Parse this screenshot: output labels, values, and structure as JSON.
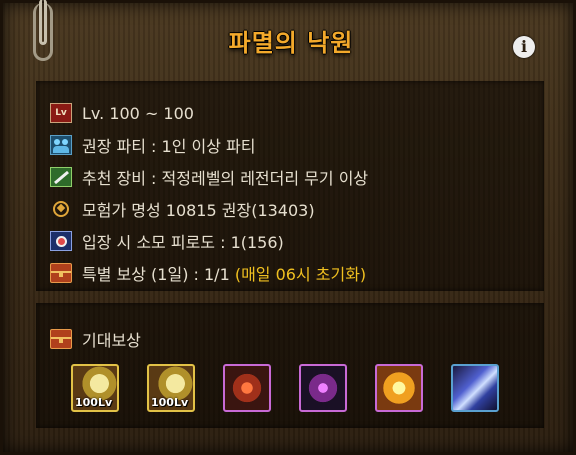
{
  "title": "파멸의 낙원",
  "info_icon": "i",
  "requirements": [
    {
      "icon": "level-icon",
      "icon_text": "Lv",
      "text": "Lv. 100 ~ 100"
    },
    {
      "icon": "party-icon",
      "text": "권장 파티 : 1인 이상 파티"
    },
    {
      "icon": "equipment-icon",
      "text": "추천 장비 : 적정레벨의 레전더리 무기 이상"
    },
    {
      "icon": "fame-icon",
      "text": "모험가 명성 10815 권장(13403)"
    },
    {
      "icon": "fatigue-icon",
      "text": "입장 시 소모 피로도 : 1(156)"
    },
    {
      "icon": "chest-icon",
      "text": "특별 보상 (1일) : 1/1 ",
      "highlight": "(매일 06시 초기화)",
      "highlight_color": "#f0c020"
    }
  ],
  "rewards": {
    "label": "기대보상",
    "items": [
      {
        "name": "equipment-box-icon",
        "level_text": "100Lv"
      },
      {
        "name": "equipment-box-icon",
        "level_text": "100Lv"
      },
      {
        "name": "red-stone-icon",
        "level_text": ""
      },
      {
        "name": "purple-claw-icon",
        "level_text": ""
      },
      {
        "name": "gold-orb-icon",
        "level_text": ""
      },
      {
        "name": "crystal-shard-icon",
        "level_text": ""
      }
    ]
  },
  "colors": {
    "title": "#f3a92b",
    "text": "#e6dfcf",
    "highlight": "#f0c020"
  }
}
